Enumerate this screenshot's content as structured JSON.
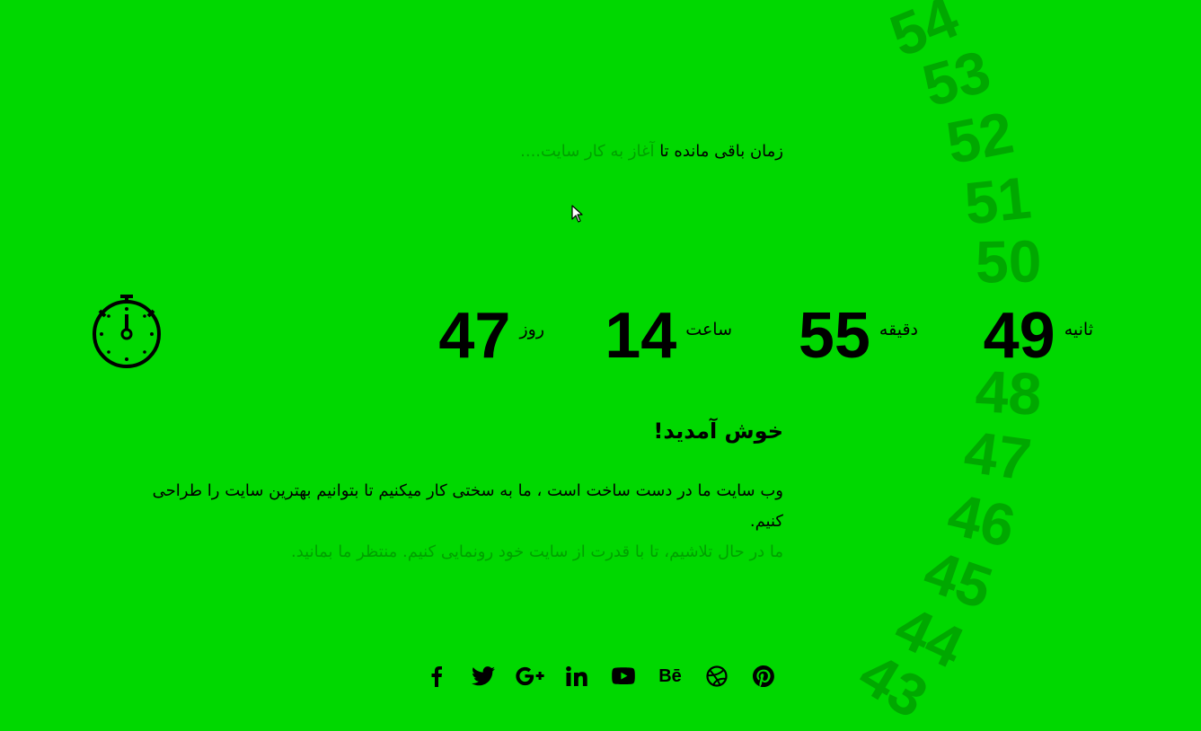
{
  "seconds_arc": [
    "54",
    "53",
    "52",
    "51",
    "50",
    "48",
    "47",
    "46",
    "45",
    "44",
    "43"
  ],
  "tagline": {
    "emphasis": "زمان باقی مانده تا",
    "rest": "آغاز به کار سایت...."
  },
  "countdown": {
    "seconds": {
      "label": "ثانیه",
      "value": "49"
    },
    "minutes": {
      "label": "دقیقه",
      "value": "55"
    },
    "hours": {
      "label": "ساعت",
      "value": "14"
    },
    "days": {
      "label": "روز",
      "value": "47"
    }
  },
  "welcome_title": "خوش آمدید!",
  "description": {
    "main": "وب سایت ما در دست ساخت است ، ما به سختی کار میکنیم تا بتوانیم بهترین سایت را طراحی کنیم.",
    "secondary": "ما در حال تلاشیم، تا با قدرت از سایت خود رونمایی کنیم. منتظر ما بمانید."
  },
  "social_icons": [
    "facebook-icon",
    "twitter-icon",
    "google-plus-icon",
    "linkedin-icon",
    "youtube-icon",
    "behance-icon",
    "dribbble-icon",
    "pinterest-icon"
  ],
  "behance_text": "Bē",
  "colors": {
    "background": "#00d800",
    "arc_numbers": "#00a800",
    "dim_text": "#00a000",
    "text": "#000000"
  }
}
